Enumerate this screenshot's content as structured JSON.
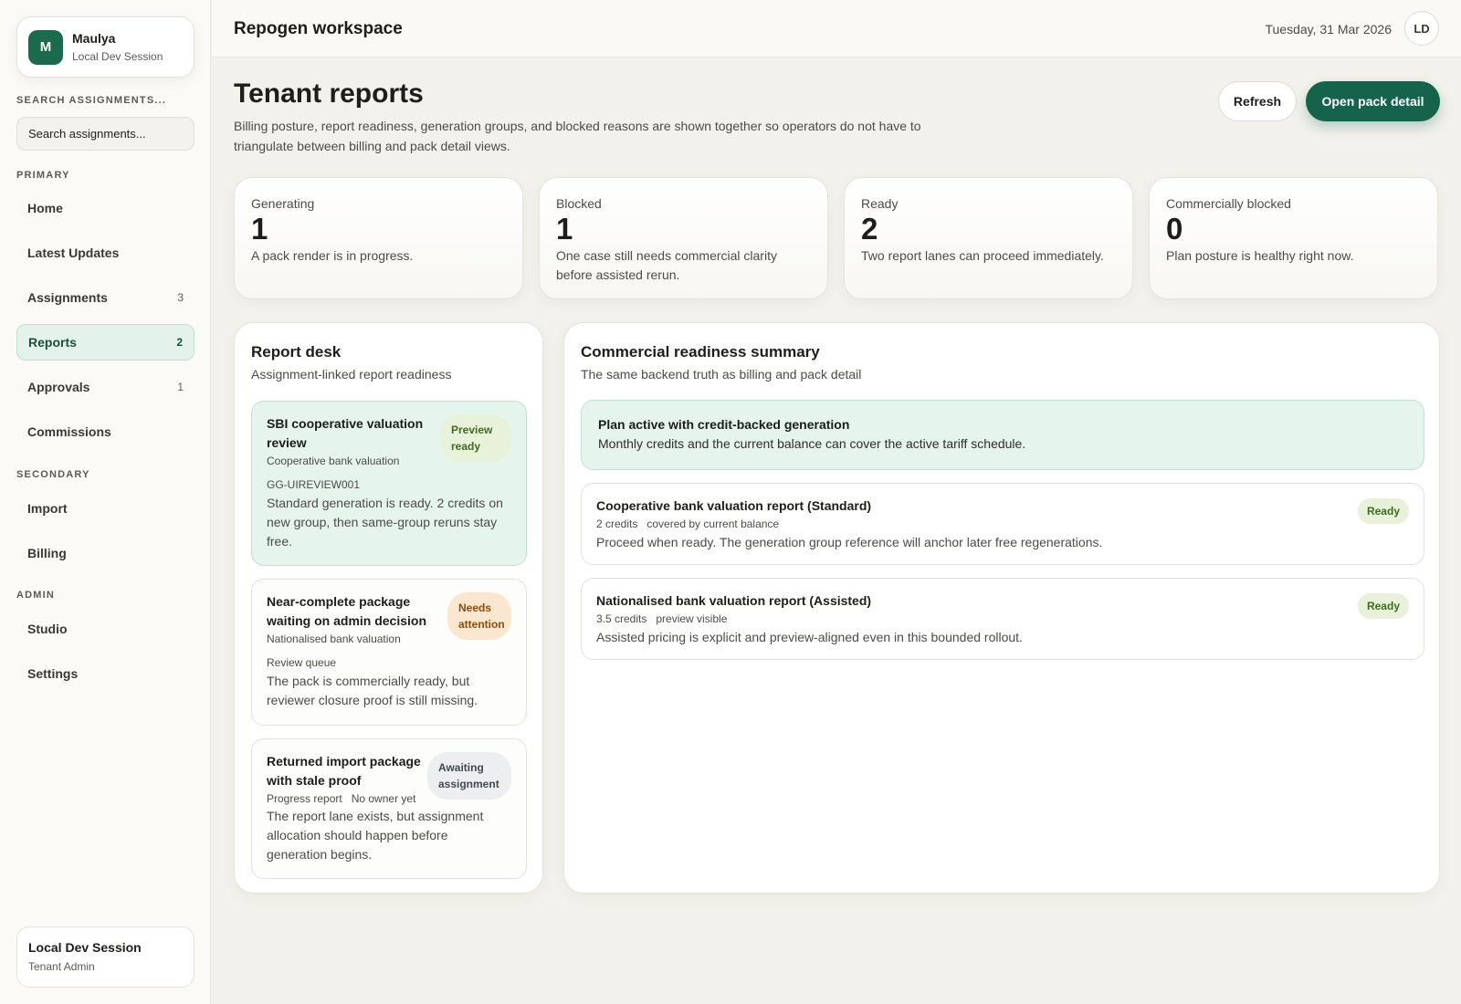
{
  "sidebar": {
    "profile": {
      "initial": "M",
      "name": "Maulya",
      "session": "Local Dev Session"
    },
    "search_label": "SEARCH ASSIGNMENTS...",
    "search_placeholder": "Search assignments...",
    "primary_label": "PRIMARY",
    "primary": [
      {
        "label": "Home",
        "count": ""
      },
      {
        "label": "Latest Updates",
        "count": ""
      },
      {
        "label": "Assignments",
        "count": "3"
      },
      {
        "label": "Reports",
        "count": "2",
        "active": true
      },
      {
        "label": "Approvals",
        "count": "1"
      },
      {
        "label": "Commissions",
        "count": ""
      }
    ],
    "secondary_label": "SECONDARY",
    "secondary": [
      {
        "label": "Import"
      },
      {
        "label": "Billing"
      }
    ],
    "admin_label": "ADMIN",
    "admin": [
      {
        "label": "Studio"
      },
      {
        "label": "Settings"
      }
    ],
    "session_card": {
      "title": "Local Dev Session",
      "role": "Tenant Admin"
    }
  },
  "topbar": {
    "title": "Repogen workspace",
    "date": "Tuesday, 31 Mar 2026",
    "user_initials": "LD"
  },
  "header": {
    "title": "Tenant reports",
    "description": "Billing posture, report readiness, generation groups, and blocked reasons are shown together so operators do not have to triangulate between billing and pack detail views.",
    "refresh_label": "Refresh",
    "open_label": "Open pack detail"
  },
  "stats": [
    {
      "label": "Generating",
      "value": "1",
      "note": "A pack render is in progress."
    },
    {
      "label": "Blocked",
      "value": "1",
      "note": "One case still needs commercial clarity before assisted rerun."
    },
    {
      "label": "Ready",
      "value": "2",
      "note": "Two report lanes can proceed immediately."
    },
    {
      "label": "Commercially blocked",
      "value": "0",
      "note": "Plan posture is healthy right now."
    }
  ],
  "report_desk": {
    "title": "Report desk",
    "subtitle": "Assignment-linked report readiness",
    "cards": [
      {
        "title": "SBI cooperative valuation review",
        "meta": [
          "Cooperative bank valuation"
        ],
        "ref": "GG-UIREVIEW001",
        "body": "Standard generation is ready. 2 credits on new group, then same-group reruns stay free.",
        "badge": "Preview ready",
        "badge_color": "#3f6b1f"
      },
      {
        "title": "Near-complete package waiting on admin decision",
        "meta": [
          "Nationalised bank valuation"
        ],
        "ref": "Review queue",
        "body": "The pack is commercially ready, but reviewer closure proof is still missing.",
        "badge": "Needs attention",
        "badge_color": "#8a4b0f"
      },
      {
        "title": "Returned import package with stale proof",
        "meta": [
          "Progress report",
          "No owner yet"
        ],
        "ref": "",
        "body": "The report lane exists, but assignment allocation should happen before generation begins.",
        "badge": "Awaiting assignment",
        "badge_color": "#3f4a55"
      }
    ]
  },
  "commercial": {
    "title": "Commercial readiness summary",
    "subtitle": "The same backend truth as billing and pack detail",
    "plan": {
      "title": "Plan active with credit-backed generation",
      "description": "Monthly credits and the current balance can cover the active tariff schedule."
    },
    "lanes": [
      {
        "title": "Cooperative bank valuation report (Standard)",
        "meta": [
          "2 credits",
          "covered by current balance"
        ],
        "description": "Proceed when ready. The generation group reference will anchor later free regenerations.",
        "badge": "Ready"
      },
      {
        "title": "Nationalised bank valuation report (Assisted)",
        "meta": [
          "3.5 credits",
          "preview visible"
        ],
        "description": "Assisted pricing is explicit and preview-aligned even in this bounded rollout.",
        "badge": "Ready"
      }
    ]
  }
}
